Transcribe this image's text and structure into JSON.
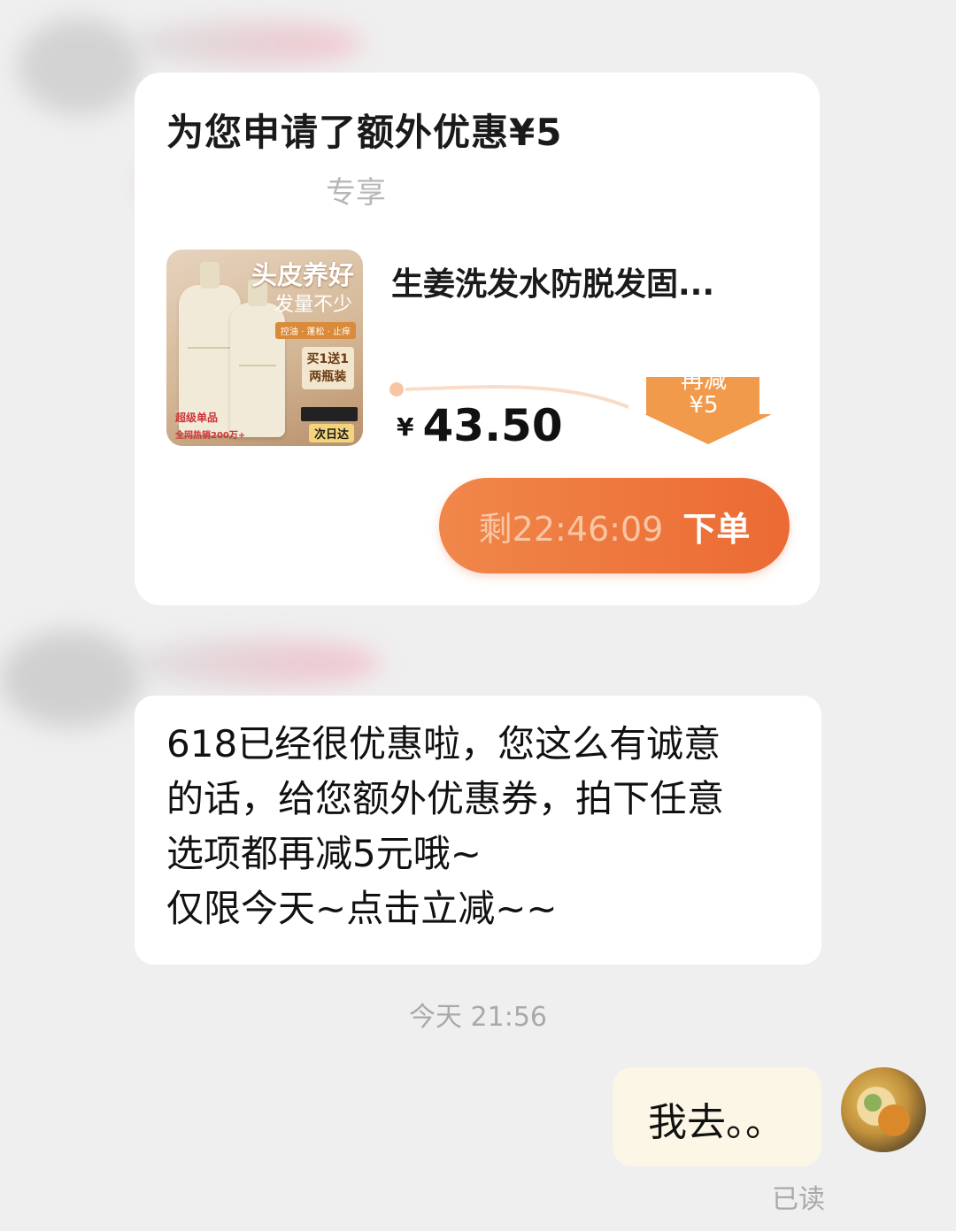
{
  "coupon_card": {
    "title": "为您申请了额外优惠¥5",
    "exclusive_label": "专享",
    "product": {
      "image_headline": "头皮养好",
      "image_subline": "发量不少",
      "image_tags": "控油 · 蓬松 · 止痒",
      "image_badge_line1": "买1送1",
      "image_badge_line2": "两瓶装",
      "image_next_day": "次日达",
      "image_super": "超级单品",
      "image_sales": "全网热销200万+",
      "name": "生姜洗发水防脱发固...",
      "currency": "¥",
      "price": "43.50",
      "reduce_line1": "再减",
      "reduce_line2": "¥5"
    },
    "order_button": {
      "countdown": "剩22:46:09",
      "label": "下单"
    }
  },
  "message": {
    "line1": "618已经很优惠啦，您这么有诚意",
    "line2": "的话，给您额外优惠券，拍下任意",
    "line3": "选项都再减5元哦~",
    "line4": "仅限今天~点击立减~~"
  },
  "timestamp": "今天 21:56",
  "reply": {
    "text": "我去。。",
    "status": "已读"
  },
  "colors": {
    "accent_orange": "#ec6a34",
    "badge_orange": "#f29a4c",
    "background": "#efefef"
  }
}
